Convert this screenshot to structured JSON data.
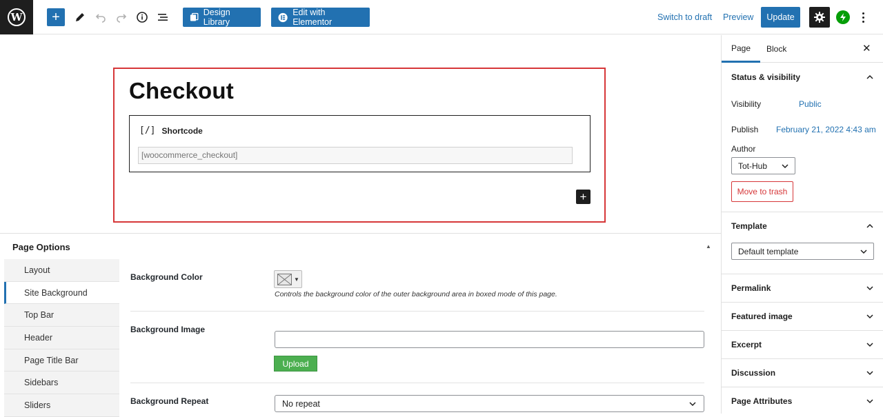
{
  "toolbar": {
    "design_library": "Design Library",
    "edit_elementor": "Edit with Elementor",
    "switch_to_draft": "Switch to draft",
    "preview": "Preview",
    "update": "Update"
  },
  "editor": {
    "page_title": "Checkout",
    "shortcode_label": "Shortcode",
    "shortcode_icon": "[/]",
    "shortcode_value": "[woocommerce_checkout]"
  },
  "page_options": {
    "title": "Page Options",
    "tabs": [
      "Layout",
      "Site Background",
      "Top Bar",
      "Header",
      "Page Title Bar",
      "Sidebars",
      "Sliders"
    ],
    "active_tab": "Site Background",
    "fields": {
      "bg_color_label": "Background Color",
      "bg_color_hint": "Controls the background color of the outer background area in boxed mode of this page.",
      "bg_image_label": "Background Image",
      "bg_image_value": "",
      "upload": "Upload",
      "bg_repeat_label": "Background Repeat",
      "bg_repeat_value": "No repeat"
    }
  },
  "sidebar": {
    "tab_page": "Page",
    "tab_block": "Block",
    "status_title": "Status & visibility",
    "visibility_label": "Visibility",
    "visibility_value": "Public",
    "publish_label": "Publish",
    "publish_value": "February 21, 2022 4:43 am",
    "author_label": "Author",
    "author_value": "Tot-Hub",
    "move_to_trash": "Move to trash",
    "template_title": "Template",
    "template_value": "Default template",
    "panels": [
      "Permalink",
      "Featured image",
      "Excerpt",
      "Discussion",
      "Page Attributes"
    ]
  },
  "colors": {
    "accent": "#2271b1",
    "danger": "#d63638",
    "upload_green": "#4caf50",
    "dark": "#1e1e1e"
  }
}
